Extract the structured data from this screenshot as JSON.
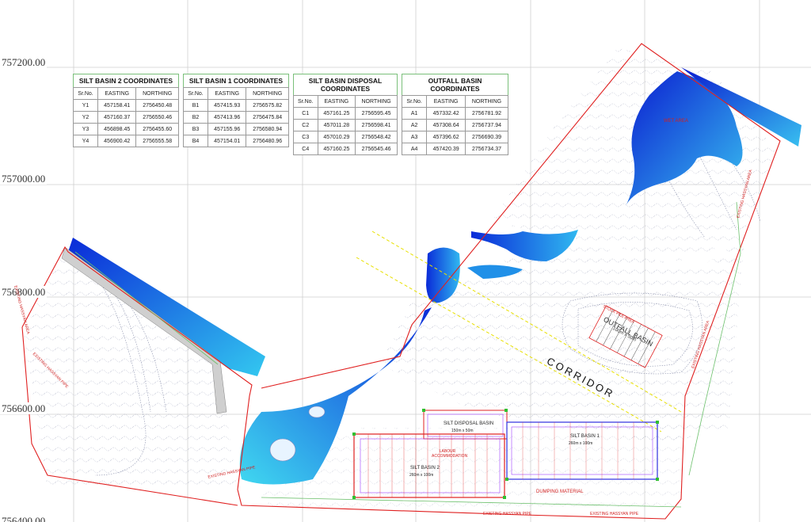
{
  "northings": [
    "757200.00",
    "757000.00",
    "756800.00",
    "756600.00",
    "756400.00"
  ],
  "tables": [
    {
      "title": "SILT BASIN 2 COORDINATES",
      "headers": [
        "Sr.No.",
        "EASTING",
        "NORTHING"
      ],
      "rows": [
        [
          "Y1",
          "457158.41",
          "2756450.48"
        ],
        [
          "Y2",
          "457160.37",
          "2756550.46"
        ],
        [
          "Y3",
          "456898.45",
          "2756455.60"
        ],
        [
          "Y4",
          "456900.42",
          "2756555.58"
        ]
      ]
    },
    {
      "title": "SILT BASIN 1 COORDINATES",
      "headers": [
        "Sr.No.",
        "EASTING",
        "NORTHING"
      ],
      "rows": [
        [
          "B1",
          "457415.93",
          "2756575.82"
        ],
        [
          "B2",
          "457413.96",
          "2756475.84"
        ],
        [
          "B3",
          "457155.96",
          "2756580.94"
        ],
        [
          "B4",
          "457154.01",
          "2756480.96"
        ]
      ]
    },
    {
      "title": "SILT BASIN DISPOSAL COORDINATES",
      "headers": [
        "Sr.No.",
        "EASTING",
        "NORTHING"
      ],
      "rows": [
        [
          "C1",
          "457161.25",
          "2756595.45"
        ],
        [
          "C2",
          "457011.28",
          "2756598.41"
        ],
        [
          "C3",
          "457010.29",
          "2756548.42"
        ],
        [
          "C4",
          "457160.25",
          "2756545.46"
        ]
      ]
    },
    {
      "title": "OUTFALL BASIN COORDINATES",
      "headers": [
        "Sr.No.",
        "EASTING",
        "NORTHING"
      ],
      "rows": [
        [
          "A1",
          "457332.42",
          "2756781.92"
        ],
        [
          "A2",
          "457308.64",
          "2756737.94"
        ],
        [
          "A3",
          "457396.62",
          "2756690.39"
        ],
        [
          "A4",
          "457420.39",
          "2756734.37"
        ]
      ]
    }
  ],
  "labels": {
    "corridor": "CORRIDOR",
    "outfall_basin": "OUTFALL BASIN",
    "outfall_dims": "100m x 50m",
    "stock_pile": "STOCK PILE AREA",
    "silt_disposal": "SILT DISPOSAL BASIN",
    "silt_disposal_dims": "150m x 50m",
    "silt_basin_1": "SILT BASIN 1",
    "silt_basin_1_dims": "260m x 100m",
    "silt_basin_2": "SILT BASIN 2",
    "silt_basin_2_dims": "260m x 100m",
    "labour": "LABOUR ACCOMMODATION",
    "dumping": "DUMPING MATERIAL",
    "wet_area": "WET AREA",
    "hassyan_left_1": "EXISTING HASSYAN AREA",
    "hassyan_left_2": "EXISTING HASSYAN PIPE",
    "hassyan_right_1": "EXISTING HASSYAN AREA",
    "hassyan_right_2": "EXISTING HASSYAN AREA",
    "pipe_bottom_1": "EXISTING HASSYAN PIPE",
    "pipe_bottom_2": "EXISTING HASSYAN PIPE",
    "pipe_bottom_3": "EXISTING HASSYAN PIPE"
  },
  "colors": {
    "boundary": "#e02020",
    "water_light": "#33c8f0",
    "water_dark": "#0a2ad8",
    "grid": "#c8c8c8",
    "contour": "#8a8fa8",
    "table_border": "#7ac07a",
    "corridor_line": "#e8e000"
  }
}
